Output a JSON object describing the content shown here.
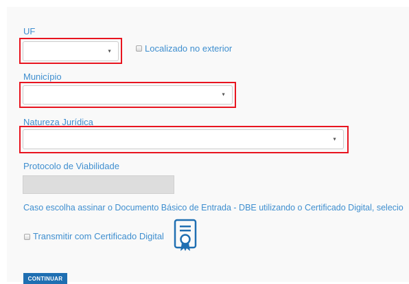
{
  "form": {
    "uf": {
      "label": "UF",
      "value": "",
      "arrow": "▼"
    },
    "exterior": {
      "label": "Localizado no exterior",
      "checked": false
    },
    "municipio": {
      "label": "Município",
      "value": "",
      "arrow": "▼"
    },
    "natureza": {
      "label": "Natureza Jurídica",
      "value": "",
      "arrow": "▼"
    },
    "protocolo": {
      "label": "Protocolo de Viabilidade",
      "value": ""
    },
    "info_text": "Caso escolha assinar o Documento Básico de Entrada - DBE utilizando o Certificado Digital, selecio",
    "certificado": {
      "label": "Transmitir com Certificado Digital",
      "checked": false,
      "icon": "certificate-icon"
    },
    "continue_button": "CONTINUAR"
  },
  "colors": {
    "label": "#3e8ecf",
    "highlight": "#e8141f",
    "button": "#1f6fb2",
    "readonly": "#dddddd"
  }
}
